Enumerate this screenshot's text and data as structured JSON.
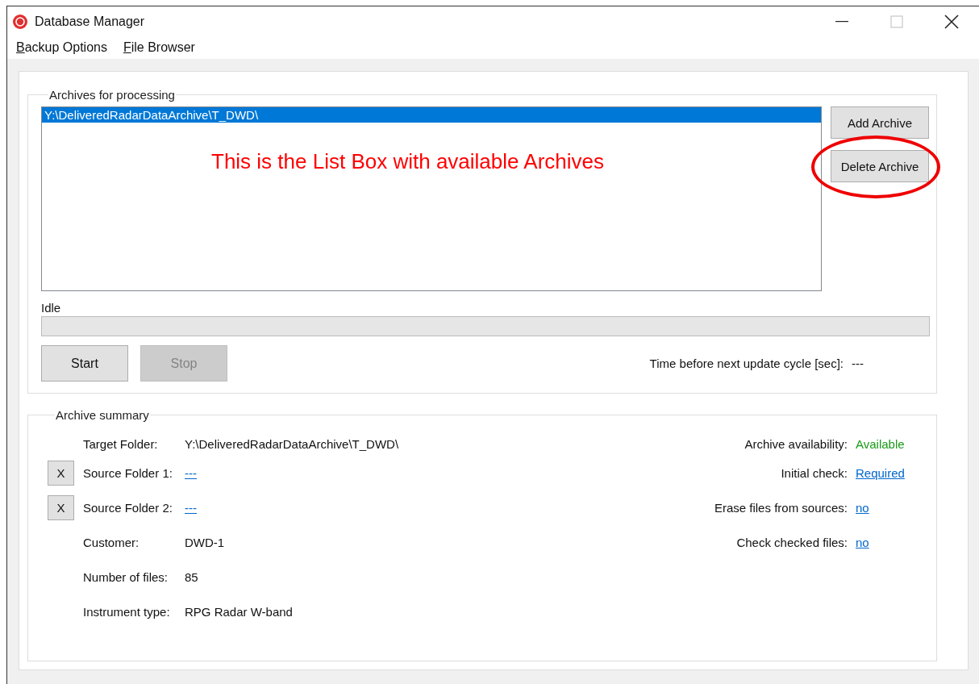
{
  "window": {
    "title": "Database Manager"
  },
  "menu": [
    {
      "label": "Backup Options"
    },
    {
      "label": "File Browser"
    }
  ],
  "archives_group": {
    "title": "Archives for processing",
    "list": [
      {
        "path": "Y:\\DeliveredRadarDataArchive\\T_DWD\\",
        "selected": true
      }
    ],
    "annotation": "This is the List Box with available Archives",
    "buttons": [
      {
        "label": "Add Archive",
        "circled": false
      },
      {
        "label": "Delete Archive",
        "circled": true
      }
    ],
    "status": "Idle",
    "progress": {
      "level": 0
    },
    "controls": [
      {
        "label": "Start",
        "disabled": false
      },
      {
        "label": "Stop",
        "disabled": true
      }
    ],
    "timer": {
      "label": "Time before next update cycle [sec]:",
      "value": "---"
    }
  },
  "summary_group": {
    "title": "Archive summary",
    "left_rows": [
      {
        "label": "Target Folder:",
        "value": "Y:\\DeliveredRadarDataArchive\\T_DWD\\",
        "kind": "text"
      },
      {
        "label": "Source Folder 1:",
        "value": "---",
        "kind": "link",
        "remove_button": "X"
      },
      {
        "label": "Source Folder 2:",
        "value": "---",
        "kind": "link",
        "remove_button": "X"
      },
      {
        "label": "Customer:",
        "value": "DWD-1",
        "kind": "text"
      },
      {
        "label": "Number of files:",
        "value": "85",
        "kind": "text"
      },
      {
        "label": "Instrument type:",
        "value": "RPG Radar W-band",
        "kind": "text"
      }
    ],
    "right_rows": [
      {
        "label": "Archive availability:",
        "value": "Available",
        "kind": "status"
      },
      {
        "label": "Initial check:",
        "value": "Required",
        "kind": "link"
      },
      {
        "label": "Erase files from sources:",
        "value": "no",
        "kind": "link"
      },
      {
        "label": "Check checked files:",
        "value": "no",
        "kind": "link"
      }
    ]
  }
}
